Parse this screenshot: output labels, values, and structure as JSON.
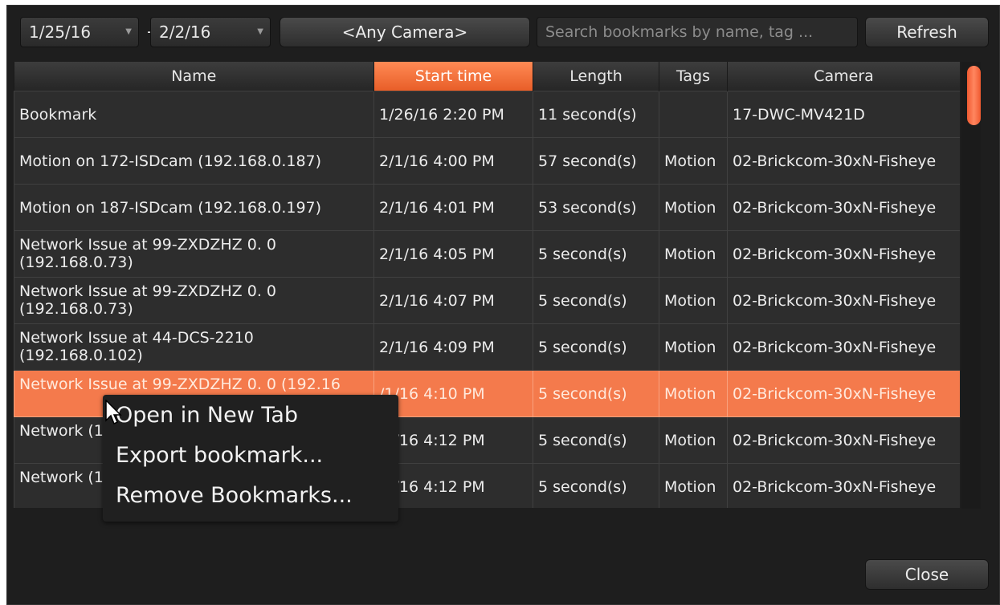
{
  "toolbar": {
    "date_from": "1/25/16",
    "date_separator": "-",
    "date_to": "2/2/16",
    "camera_filter": "<Any Camera>",
    "search_placeholder": "Search bookmarks by name, tag ...",
    "refresh_label": "Refresh"
  },
  "table": {
    "columns": [
      "Name",
      "Start time",
      "Length",
      "Tags",
      "Camera"
    ],
    "sorted_column": "Start time",
    "rows": [
      {
        "name": "Bookmark",
        "start": "1/26/16 2:20 PM",
        "length": "11 second(s)",
        "tags": "",
        "camera": "17-DWC-MV421D"
      },
      {
        "name": "Motion on 172-ISDcam (192.168.0.187)",
        "start": "2/1/16 4:00 PM",
        "length": "57 second(s)",
        "tags": "Motion",
        "camera": "02-Brickcom-30xN-Fisheye"
      },
      {
        "name": "Motion on 187-ISDcam (192.168.0.197)",
        "start": "2/1/16 4:01 PM",
        "length": "53 second(s)",
        "tags": "Motion",
        "camera": "02-Brickcom-30xN-Fisheye"
      },
      {
        "name": "Network Issue at 99-ZXDZHZ        0. 0 (192.168.0.73)",
        "start": "2/1/16 4:05 PM",
        "length": "5 second(s)",
        "tags": "Motion",
        "camera": "02-Brickcom-30xN-Fisheye"
      },
      {
        "name": "Network Issue at 99-ZXDZHZ        0. 0 (192.168.0.73)",
        "start": "2/1/16 4:07 PM",
        "length": "5 second(s)",
        "tags": "Motion",
        "camera": "02-Brickcom-30xN-Fisheye"
      },
      {
        "name": "Network Issue at 44-DCS-2210 (192.168.0.102)",
        "start": "2/1/16 4:09 PM",
        "length": "5 second(s)",
        "tags": "Motion",
        "camera": "02-Brickcom-30xN-Fisheye"
      },
      {
        "name": "Network Issue at 99-ZXDZHZ        0. 0 (192.16",
        "start": "/1/16 4:10 PM",
        "length": "5 second(s)",
        "tags": "Motion",
        "camera": "02-Brickcom-30xN-Fisheye",
        "selected": true
      },
      {
        "name": "Network (192.168",
        "start": "/1/16 4:12 PM",
        "length": "5 second(s)",
        "tags": "Motion",
        "camera": "02-Brickcom-30xN-Fisheye"
      },
      {
        "name": "Network (192.168",
        "start": "/1/16 4:12 PM",
        "length": "5 second(s)",
        "tags": "Motion",
        "camera": "02-Brickcom-30xN-Fisheye"
      }
    ]
  },
  "context_menu": {
    "items": [
      "Open in New Tab",
      "Export bookmark...",
      "Remove Bookmarks..."
    ]
  },
  "footer": {
    "close_label": "Close"
  },
  "colors": {
    "accent": "#f47a4c",
    "background": "#1e1e1e",
    "row": "#2d2d2d"
  }
}
